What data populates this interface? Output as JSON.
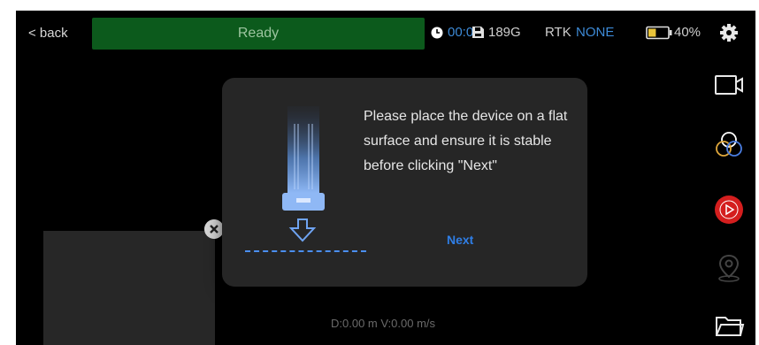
{
  "header": {
    "back_label": "< back",
    "status_text": "Ready",
    "timer": "00:00",
    "storage": "189G",
    "rtk_label": "RTK",
    "rtk_value": "NONE",
    "battery_percent": "40%",
    "battery_level": 0.4
  },
  "dialog": {
    "message": "Please place the device on a flat surface and ensure it is stable before clicking \"Next\"",
    "next_label": "Next"
  },
  "telemetry": {
    "text": "D:0.00 m V:0.00 m/s"
  },
  "sidebar": {
    "items": [
      {
        "icon": "video-camera-icon"
      },
      {
        "icon": "color-filter-icon"
      },
      {
        "icon": "record-play-icon"
      },
      {
        "icon": "location-pin-icon"
      },
      {
        "icon": "folder-icon"
      }
    ]
  },
  "colors": {
    "status_green": "#0c5a1c",
    "accent_blue": "#3d8ad6",
    "record_red": "#d41e1e",
    "dialog_bg": "#262626"
  }
}
